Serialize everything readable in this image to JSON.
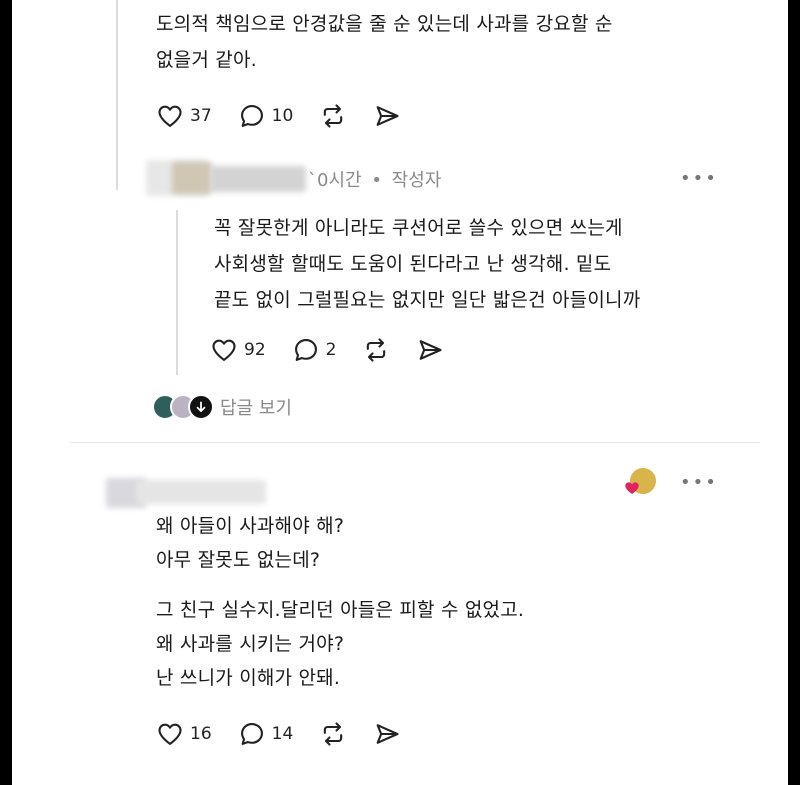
{
  "post1": {
    "body_lines": [
      "도의적 책임으로 안경값을 줄 순 있는데 사과를 강요할 순",
      "없을거 같아."
    ],
    "likes": "37",
    "replies": "10"
  },
  "reply1": {
    "time_suffix": "`0시간",
    "separator": "•",
    "author_tag": "작성자",
    "body_lines": [
      "꼭 잘못한게 아니라도 쿠션어로 쓸수 있으면 쓰는게",
      "사회생할 할때도 도움이 된다라고 난 생각해. 밑도",
      "끝도 없이 그럴필요는 없지만 일단 밟은건 아들이니까"
    ],
    "likes": "92",
    "replies": "2",
    "view_replies_label": "답글 보기"
  },
  "post2": {
    "body_lines_a": [
      "왜 아들이 사과해야 해?",
      "아무 잘못도 없는데?"
    ],
    "body_lines_b": [
      "그 친구 실수지.달리던 아들은 피할 수 없었고.",
      "왜 사과를 시키는 거야?",
      "난 쓰니가 이해가 안돼."
    ],
    "likes": "16",
    "replies": "14"
  },
  "icons": {
    "like": "heart-icon",
    "reply": "comment-bubble-icon",
    "repost": "repost-icon",
    "share": "send-icon",
    "more": "more-icon"
  },
  "more_label": "•••",
  "colors": {
    "text": "#1a1a1a",
    "muted": "#8a8a8a",
    "heart_red": "#e0245e"
  }
}
